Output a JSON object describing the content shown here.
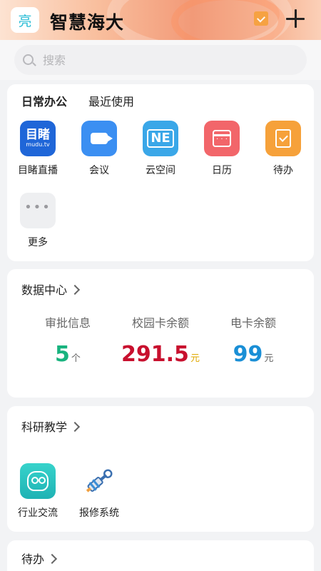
{
  "header": {
    "logo_text": "亮",
    "title": "智慧海大",
    "icons": [
      "gift-icon",
      "plus-icon"
    ]
  },
  "search": {
    "placeholder": "搜索",
    "value": ""
  },
  "office": {
    "tabs": [
      {
        "label": "日常办公",
        "active": true
      },
      {
        "label": "最近使用",
        "active": false
      }
    ],
    "apps": [
      {
        "label": "目睹直播",
        "icon_text": "目睹",
        "icon_subtext": "mudu.tv",
        "icon": "mudu-icon",
        "color": "#1f66d8"
      },
      {
        "label": "会议",
        "icon": "video-camera-icon",
        "color": "#3b8ff2"
      },
      {
        "label": "云空间",
        "icon_text": "NE",
        "icon": "cloud-space-icon",
        "color": "#3aa7e8"
      },
      {
        "label": "日历",
        "icon": "calendar-icon",
        "color": "#f2666a"
      },
      {
        "label": "待办",
        "icon": "todo-icon",
        "color": "#f6a13a"
      },
      {
        "label": "更多",
        "icon": "more-icon",
        "color": "#eeeff1"
      }
    ]
  },
  "data_center": {
    "title": "数据中心",
    "stats": [
      {
        "label": "审批信息",
        "value": "5",
        "unit": "个",
        "color": "#18b37e"
      },
      {
        "label": "校园卡余额",
        "value": "291.5",
        "unit": "元",
        "color": "#c8102e",
        "unit_color": "#e0a800"
      },
      {
        "label": "电卡余额",
        "value": "99",
        "unit": "元",
        "color": "#1a8fd6",
        "unit_color": "#666666"
      }
    ]
  },
  "research": {
    "title": "科研教学",
    "apps": [
      {
        "label": "行业交流",
        "icon": "industry-exchange-icon",
        "color": "#26bdb9"
      },
      {
        "label": "报修系统",
        "icon": "wrench-plug-icon",
        "color": "#3a8fd6"
      }
    ]
  },
  "todo_section": {
    "title": "待办"
  }
}
